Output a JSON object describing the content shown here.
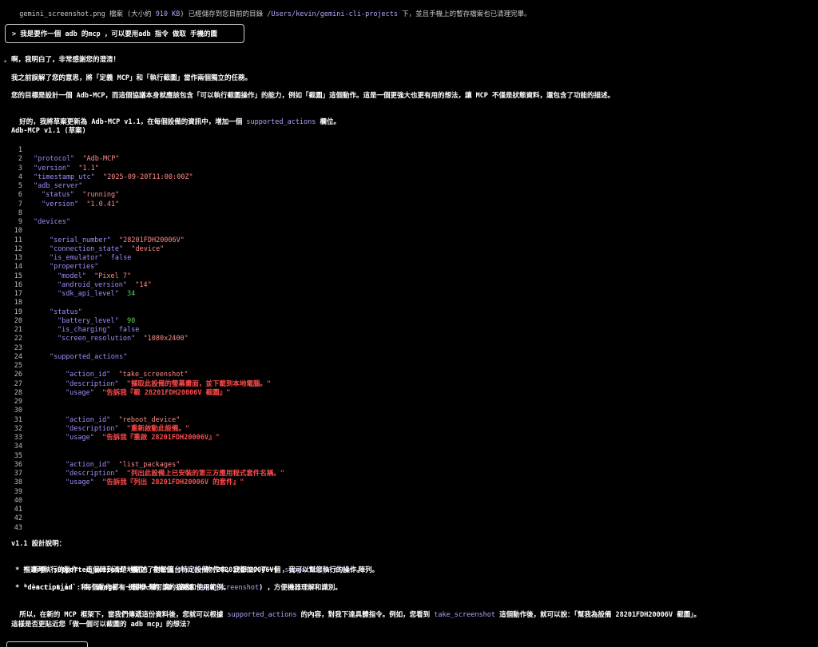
{
  "top_line": {
    "pre": "gemini_screenshot.png 檔案 (大小約 ",
    "size": "910 KB",
    "mid": ") 已經儲存到您目前的目錄 ",
    "path": "/Users/kevin/gemini-cli-projects",
    "post": " 下，並且手機上的暫存檔案也已清理完畢。"
  },
  "prompt": "> 我是要作一個 adb 的mcp ，可以要用adb 指令 做取 手機的圖",
  "response": {
    "p1": "啊，我明白了，非常感謝您的澄清！",
    "p2": "我之前誤解了您的意思，將「定義 MCP」和「執行截圖」當作兩個獨立的任務。",
    "p3": "您的目標是設計一個 Adb-MCP，而這個協議本身就應該包含「可以執行截圖操作」的能力，例如「截圖」這個動作。這是一個更強大也更有用的想法，讓 MCP 不僅是狀態資料，還包含了功能的描述。",
    "p4_pre": "好的，我將草案更新為 Adb-MCP v1.1，在每個設備的資訊中，增加一個 ",
    "p4_kw": "supported_actions",
    "p4_post": " 欄位。",
    "heading": "Adb-MCP v1.1 (草案)"
  },
  "code_lines": [
    {
      "n": "1",
      "indent": 0,
      "parts": []
    },
    {
      "n": "2",
      "indent": 1,
      "parts": [
        [
          "key",
          "\"protocol\""
        ],
        [
          "dim",
          "  "
        ],
        [
          "str",
          "\"Adb-MCP\""
        ]
      ]
    },
    {
      "n": "3",
      "indent": 1,
      "parts": [
        [
          "key",
          "\"version\""
        ],
        [
          "dim",
          "  "
        ],
        [
          "str",
          "\"1.1\""
        ]
      ]
    },
    {
      "n": "4",
      "indent": 1,
      "parts": [
        [
          "key",
          "\"timestamp_utc\""
        ],
        [
          "dim",
          "  "
        ],
        [
          "str",
          "\"2025-09-20T11:00:00Z\""
        ]
      ]
    },
    {
      "n": "5",
      "indent": 1,
      "parts": [
        [
          "key",
          "\"adb_server\""
        ]
      ]
    },
    {
      "n": "6",
      "indent": 2,
      "parts": [
        [
          "key",
          "\"status\""
        ],
        [
          "dim",
          "  "
        ],
        [
          "str",
          "\"running\""
        ]
      ]
    },
    {
      "n": "7",
      "indent": 2,
      "parts": [
        [
          "key",
          "\"version\""
        ],
        [
          "dim",
          "  "
        ],
        [
          "str",
          "\"1.0.41\""
        ]
      ]
    },
    {
      "n": "8",
      "indent": 0,
      "parts": []
    },
    {
      "n": "9",
      "indent": 1,
      "parts": [
        [
          "key",
          "\"devices\""
        ]
      ]
    },
    {
      "n": "10",
      "indent": 0,
      "parts": []
    },
    {
      "n": "11",
      "indent": 3,
      "parts": [
        [
          "key",
          "\"serial_number\""
        ],
        [
          "dim",
          "  "
        ],
        [
          "str",
          "\"28201FDH20006V\""
        ]
      ]
    },
    {
      "n": "12",
      "indent": 3,
      "parts": [
        [
          "key",
          "\"connection_state\""
        ],
        [
          "dim",
          "  "
        ],
        [
          "str",
          "\"device\""
        ]
      ]
    },
    {
      "n": "13",
      "indent": 3,
      "parts": [
        [
          "key",
          "\"is_emulator\""
        ],
        [
          "dim",
          "  "
        ],
        [
          "key",
          "false"
        ]
      ]
    },
    {
      "n": "14",
      "indent": 3,
      "parts": [
        [
          "key",
          "\"properties\""
        ]
      ]
    },
    {
      "n": "15",
      "indent": 4,
      "parts": [
        [
          "key",
          "\"model\""
        ],
        [
          "dim",
          "  "
        ],
        [
          "str",
          "\"Pixel 7\""
        ]
      ]
    },
    {
      "n": "16",
      "indent": 4,
      "parts": [
        [
          "key",
          "\"android_version\""
        ],
        [
          "dim",
          "  "
        ],
        [
          "str",
          "\"14\""
        ]
      ]
    },
    {
      "n": "17",
      "indent": 4,
      "parts": [
        [
          "key",
          "\"sdk_api_level\""
        ],
        [
          "dim",
          "  "
        ],
        [
          "num",
          "34"
        ]
      ]
    },
    {
      "n": "18",
      "indent": 0,
      "parts": []
    },
    {
      "n": "19",
      "indent": 3,
      "parts": [
        [
          "key",
          "\"status\""
        ]
      ]
    },
    {
      "n": "20",
      "indent": 4,
      "parts": [
        [
          "key",
          "\"battery_level\""
        ],
        [
          "dim",
          "  "
        ],
        [
          "num",
          "90"
        ]
      ]
    },
    {
      "n": "21",
      "indent": 4,
      "parts": [
        [
          "key",
          "\"is_charging\""
        ],
        [
          "dim",
          "  "
        ],
        [
          "key",
          "false"
        ]
      ]
    },
    {
      "n": "22",
      "indent": 4,
      "parts": [
        [
          "key",
          "\"screen_resolution\""
        ],
        [
          "dim",
          "  "
        ],
        [
          "str",
          "\"1080x2400\""
        ]
      ]
    },
    {
      "n": "23",
      "indent": 0,
      "parts": []
    },
    {
      "n": "24",
      "indent": 3,
      "parts": [
        [
          "key",
          "\"supported_actions\""
        ]
      ]
    },
    {
      "n": "25",
      "indent": 0,
      "parts": []
    },
    {
      "n": "26",
      "indent": 5,
      "parts": [
        [
          "key",
          "\"action_id\""
        ],
        [
          "dim",
          "  "
        ],
        [
          "str",
          "\"take_screenshot\""
        ]
      ]
    },
    {
      "n": "27",
      "indent": 5,
      "parts": [
        [
          "key",
          "\"description\""
        ],
        [
          "dim",
          "  "
        ],
        [
          "strong",
          "\"擷取此設備的螢幕畫面，並下載到本地電腦。\""
        ]
      ]
    },
    {
      "n": "28",
      "indent": 5,
      "parts": [
        [
          "key",
          "\"usage\""
        ],
        [
          "dim",
          "  "
        ],
        [
          "strong",
          "\"告訴我『截 28201FDH20006V 截圖』\""
        ]
      ]
    },
    {
      "n": "29",
      "indent": 0,
      "parts": []
    },
    {
      "n": "30",
      "indent": 0,
      "parts": []
    },
    {
      "n": "31",
      "indent": 5,
      "parts": [
        [
          "key",
          "\"action_id\""
        ],
        [
          "dim",
          "  "
        ],
        [
          "str",
          "\"reboot_device\""
        ]
      ]
    },
    {
      "n": "32",
      "indent": 5,
      "parts": [
        [
          "key",
          "\"description\""
        ],
        [
          "dim",
          "  "
        ],
        [
          "strong",
          "\"重新啟動此設備。\""
        ]
      ]
    },
    {
      "n": "33",
      "indent": 5,
      "parts": [
        [
          "key",
          "\"usage\""
        ],
        [
          "dim",
          "  "
        ],
        [
          "strong",
          "\"告訴我『重啟 28201FDH20006V』\""
        ]
      ]
    },
    {
      "n": "34",
      "indent": 0,
      "parts": []
    },
    {
      "n": "35",
      "indent": 0,
      "parts": []
    },
    {
      "n": "36",
      "indent": 5,
      "parts": [
        [
          "key",
          "\"action_id\""
        ],
        [
          "dim",
          "  "
        ],
        [
          "str",
          "\"list_packages\""
        ]
      ]
    },
    {
      "n": "37",
      "indent": 5,
      "parts": [
        [
          "key",
          "\"description\""
        ],
        [
          "dim",
          "  "
        ],
        [
          "strong",
          "\"列出此設備上已安裝的第三方應用程式套件名稱。\""
        ]
      ]
    },
    {
      "n": "38",
      "indent": 5,
      "parts": [
        [
          "key",
          "\"usage\""
        ],
        [
          "dim",
          "  "
        ],
        [
          "strong",
          "\"告訴我『列出 28201FDH20006V 的套件』\""
        ]
      ]
    },
    {
      "n": "39",
      "indent": 0,
      "parts": []
    },
    {
      "n": "40",
      "indent": 0,
      "parts": []
    },
    {
      "n": "41",
      "indent": 0,
      "parts": []
    },
    {
      "n": "42",
      "indent": 0,
      "parts": []
    },
    {
      "n": "43",
      "indent": 0,
      "parts": []
    }
  ],
  "design": {
    "heading": "v1.1 設計說明：",
    "b1_pre": " * 新增 `supported_actions` 欄位: 在每個 ",
    "b1_kw1": "device",
    "b1_mid": " 物件中，我都加入了一個 ",
    "b1_kw2": "supported_actions",
    "b1_post": " 陣列。",
    "b2_pre": " * 描述可執行的動作: 這個陣列清楚地描述了對於這台特定設備 (28201FDH20006V) ，我可以幫您執行的操作。",
    "b3_pre": " * `action_id`: 每個動作都有一個唯一的 ID (例如 ",
    "b3_kw": "take_screenshot",
    "b3_post": ") ，方便機器理解和識別。",
    "b4": " * `description` 和 `usage`: 提供人類可讀的描述和使用範例。"
  },
  "closing": {
    "pre": "所以，在新的 MCP 框架下，當我們傳遞這份資料後，您就可以根據 ",
    "kw1": "supported_actions",
    "mid": " 的內容，對我下達具體指令。例如，您看到 ",
    "kw2": "take_screenshot",
    "post": " 這個動作後，就可以說：「幫我為設備 28201FDH20006V 截圖」。"
  },
  "question": "這樣是否更貼近您「做一個可以截圖的 adb mcp」的想法？"
}
